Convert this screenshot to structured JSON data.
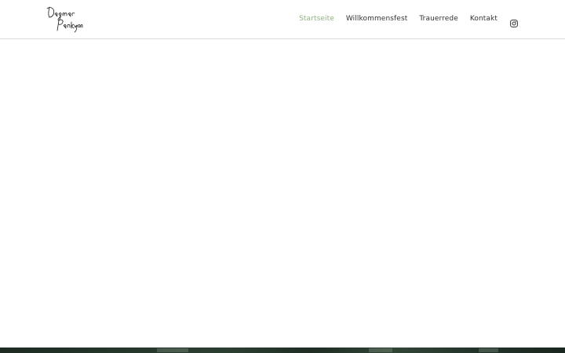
{
  "header": {
    "logo_alt": "Dagmar Pankgon",
    "nav": [
      {
        "label": "Startseite",
        "active": true
      },
      {
        "label": "Willkommensfest",
        "active": false
      },
      {
        "label": "Trauerrede",
        "active": false
      },
      {
        "label": "Kontakt",
        "active": false
      }
    ],
    "social_icon": "instagram-icon"
  },
  "colors": {
    "accent": "#8fb27c",
    "nav_text": "#333333",
    "divider": "#d9d9d9",
    "hero_dark": "#1d2b22"
  }
}
